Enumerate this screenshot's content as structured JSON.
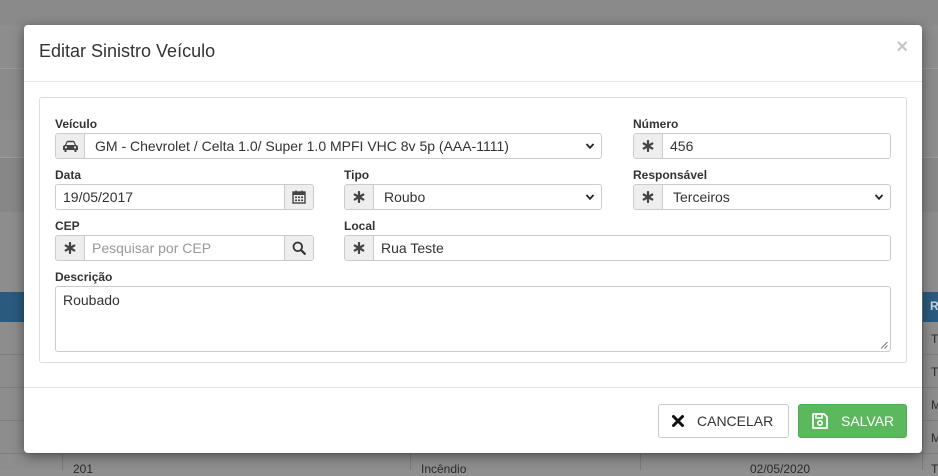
{
  "modal": {
    "title": "Editar Sinistro Veículo",
    "close_label": "×"
  },
  "form": {
    "veiculo": {
      "label": "Veículo",
      "value": "GM - Chevrolet / Celta 1.0/ Super 1.0 MPFI VHC 8v 5p (AAA-1111)",
      "icon": "car-icon"
    },
    "numero": {
      "label": "Número",
      "value": "456",
      "icon": "asterisk-icon"
    },
    "data": {
      "label": "Data",
      "value": "19/05/2017",
      "icon": "calendar-icon"
    },
    "tipo": {
      "label": "Tipo",
      "value": "Roubo",
      "icon": "asterisk-icon"
    },
    "responsavel": {
      "label": "Responsável",
      "value": "Terceiros",
      "icon": "asterisk-icon"
    },
    "cep": {
      "label": "CEP",
      "value": "",
      "placeholder": "Pesquisar por CEP",
      "icon": "asterisk-icon",
      "search_icon": "search-icon"
    },
    "local": {
      "label": "Local",
      "value": "Rua Teste",
      "icon": "asterisk-icon"
    },
    "descricao": {
      "label": "Descrição",
      "value": "Roubado"
    }
  },
  "footer": {
    "cancel_label": "CANCELAR",
    "save_label": "SALVAR"
  },
  "background": {
    "row_texts": [
      "201",
      "Incêndio",
      "02/05/2020"
    ],
    "side_letters": [
      "R",
      "T",
      "T",
      "M",
      "M",
      "T"
    ]
  },
  "colors": {
    "save_button": "#5cb85c",
    "header_blue": "#2a5a7e",
    "overlay": "#8d8d8d"
  }
}
